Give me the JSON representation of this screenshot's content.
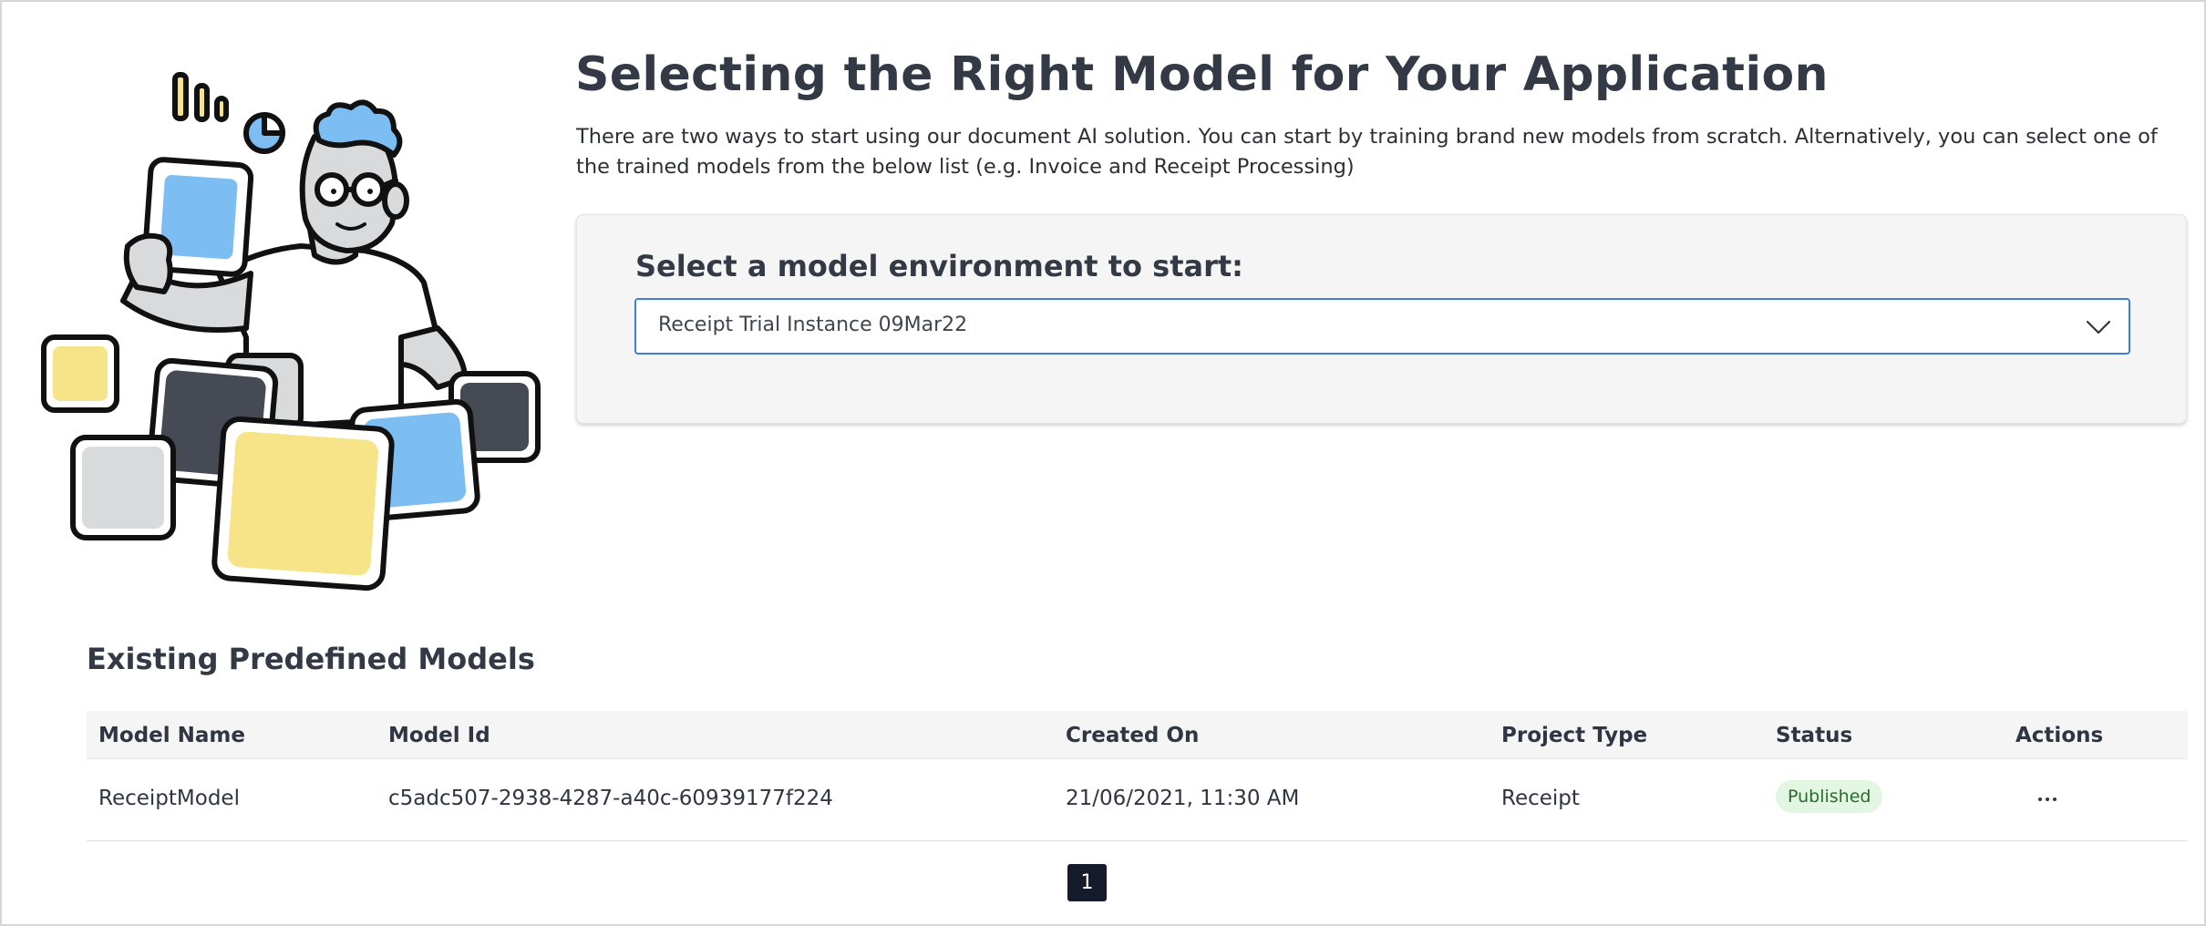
{
  "header": {
    "title": "Selecting the Right Model for Your Application",
    "intro": "There are two ways to start using our document AI solution. You can start by training brand new models from scratch. Alternatively, you can select one of the trained models from the below list (e.g. Invoice and Receipt Processing)"
  },
  "environment": {
    "label": "Select a model environment to start:",
    "selected": "Receipt Trial Instance 09Mar22",
    "icon": "chevron-down-icon"
  },
  "models_section": {
    "title": "Existing Predefined Models",
    "columns": [
      "Model Name",
      "Model Id",
      "Created On",
      "Project Type",
      "Status",
      "Actions"
    ],
    "rows": [
      {
        "name": "ReceiptModel",
        "id": "c5adc507-2938-4287-a40c-60939177f224",
        "created_on": "21/06/2021, 11:30 AM",
        "project_type": "Receipt",
        "status": "Published",
        "actions_icon": "more-horizontal-icon"
      }
    ]
  },
  "pagination": {
    "current_page": "1"
  },
  "colors": {
    "accent": "#3d7fd6",
    "status_bg": "#e2f6e1",
    "status_text": "#2a6b2e",
    "pagination_bg": "#151b2b",
    "illustration_blue": "#7cbdf2",
    "illustration_yellow": "#f7e488",
    "illustration_dark": "#464a55",
    "illustration_gray": "#d9dadc"
  }
}
